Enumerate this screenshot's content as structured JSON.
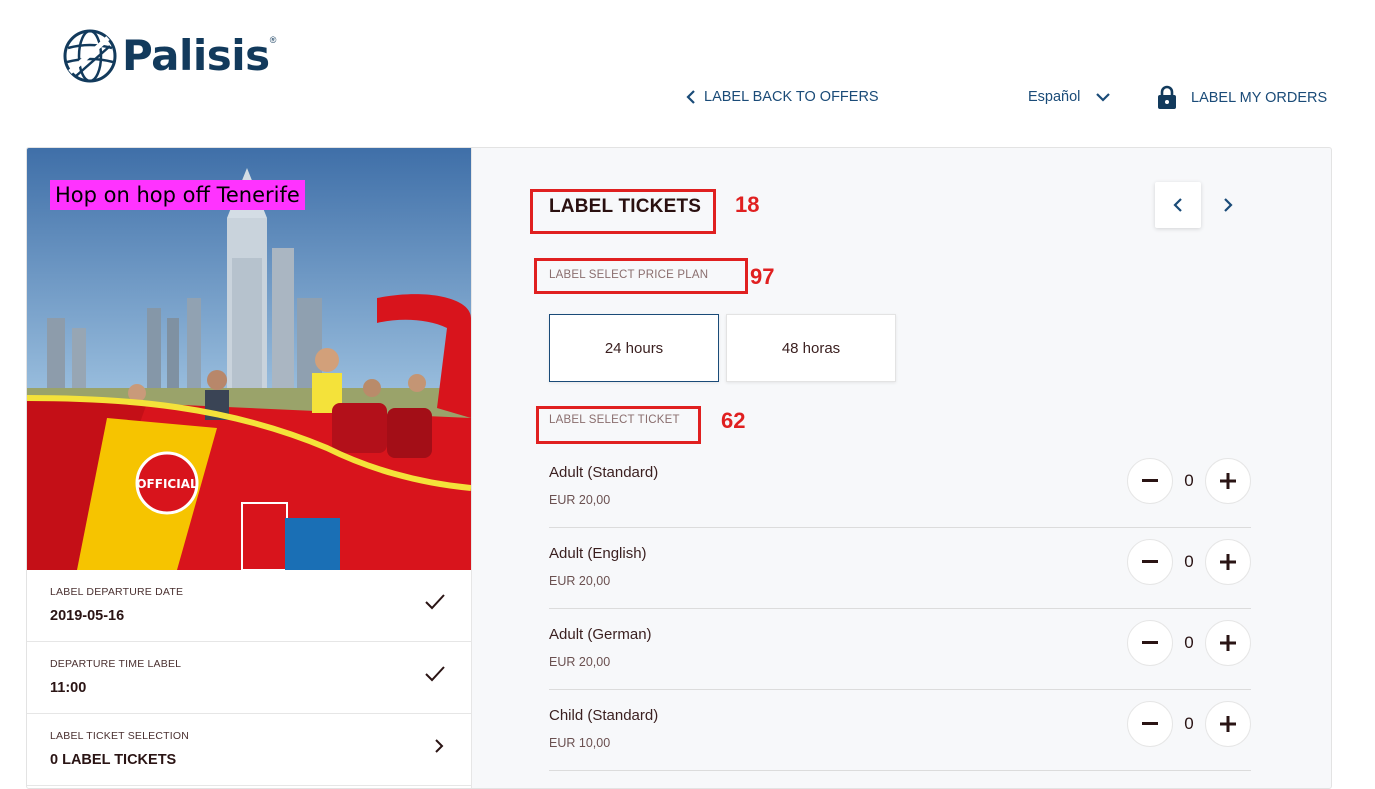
{
  "brand": {
    "name": "Palisis",
    "reg": "®"
  },
  "header": {
    "back_label": "LABEL BACK TO OFFERS",
    "language": "Español",
    "orders_label": "LABEL MY ORDERS"
  },
  "offer": {
    "title": "Hop on hop off Tenerife"
  },
  "summary": [
    {
      "label": "LABEL DEPARTURE DATE",
      "value": "2019-05-16",
      "icon": "check-icon"
    },
    {
      "label": "DEPARTURE TIME LABEL",
      "value": "11:00",
      "icon": "check-icon"
    },
    {
      "label": "LABEL TICKET SELECTION",
      "value": "0 LABEL TICKETS",
      "icon": "chevron-right-icon"
    }
  ],
  "tickets_section": {
    "title": "LABEL TICKETS",
    "price_plan_label": "LABEL SELECT PRICE PLAN",
    "ticket_label": "LABEL SELECT TICKET",
    "price_plans": [
      {
        "label": "24 hours",
        "selected": true
      },
      {
        "label": "48 horas",
        "selected": false
      }
    ],
    "tickets": [
      {
        "name": "Adult (Standard)",
        "price": "EUR 20,00",
        "qty": "0"
      },
      {
        "name": "Adult (English)",
        "price": "EUR 20,00",
        "qty": "0"
      },
      {
        "name": "Adult (German)",
        "price": "EUR 20,00",
        "qty": "0"
      },
      {
        "name": "Child (Standard)",
        "price": "EUR 10,00",
        "qty": "0"
      }
    ]
  },
  "annotations": [
    "18",
    "97",
    "62"
  ],
  "colors": {
    "accent": "#1a4b78",
    "annotation": "#e02020",
    "highlight": "#ff33ff"
  }
}
